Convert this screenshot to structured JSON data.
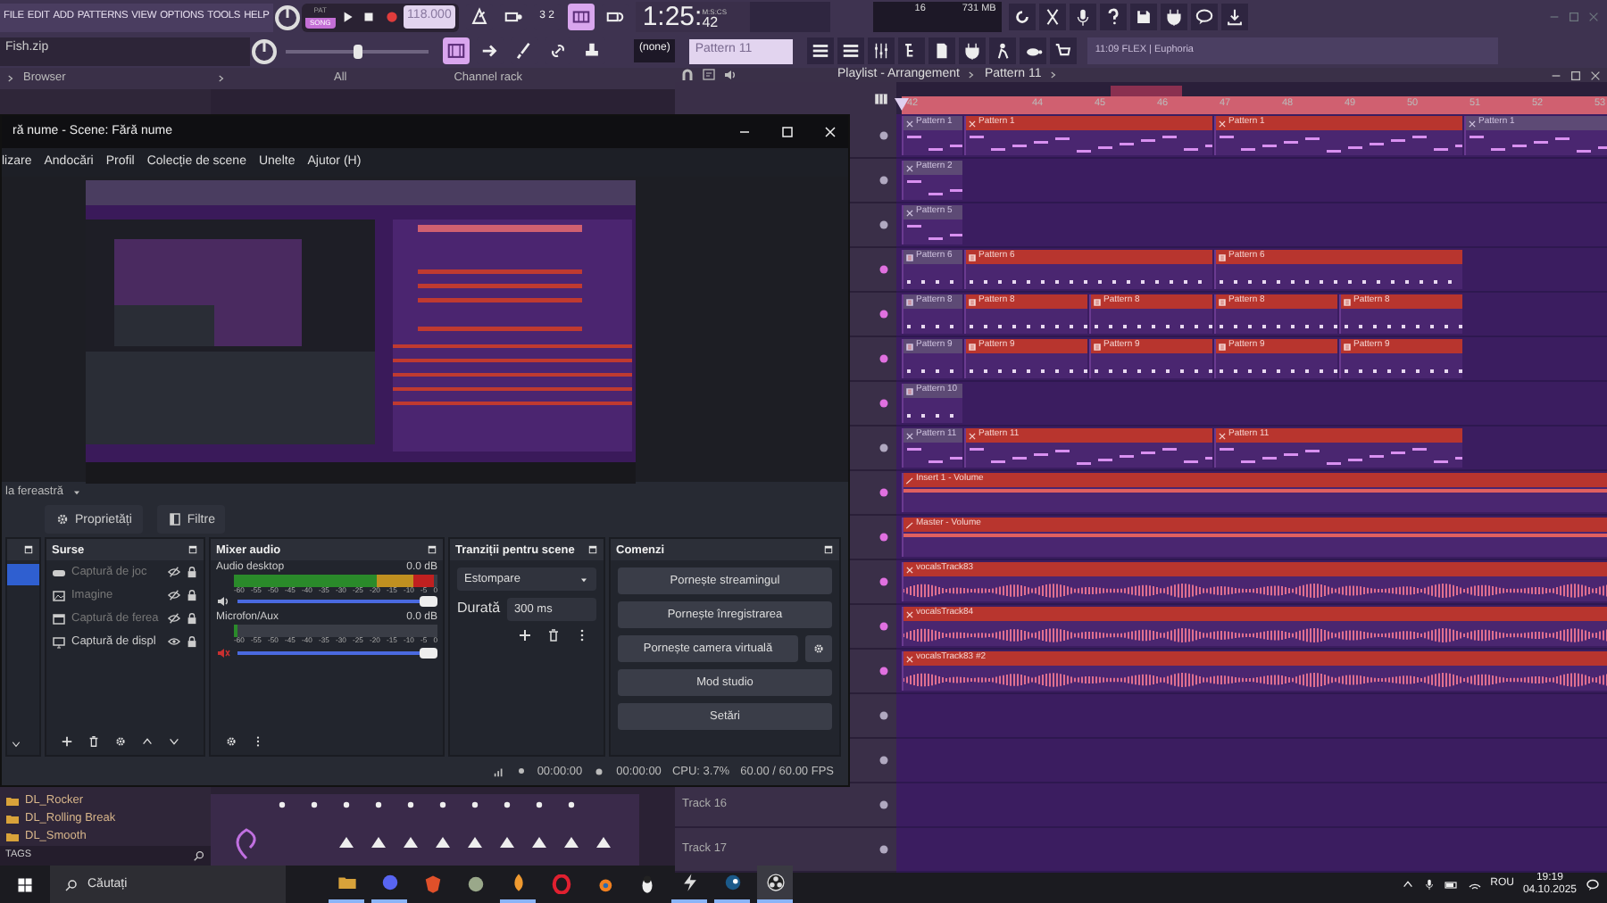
{
  "fl": {
    "menu": [
      "FILE",
      "EDIT",
      "ADD",
      "PATTERNS",
      "VIEW",
      "OPTIONS",
      "TOOLS",
      "HELP"
    ],
    "hint": "Fish.zip",
    "mode": {
      "pat_label": "PAT",
      "song_label": "SONG",
      "song_selected": true
    },
    "tempo": "118.000",
    "time": {
      "main": "1:25:",
      "small": "42",
      "unit": "M:S:CS"
    },
    "cpu": {
      "polyphony": "16",
      "memory": "731 MB"
    },
    "pitch": {
      "level": 0.5
    },
    "snap": "(none)",
    "pattern": "Pattern 11",
    "news": "11:09 FLEX | Euphoria",
    "toggles_top": [
      {
        "kind": "metronome",
        "on": false
      },
      {
        "kind": "wait",
        "on": false
      },
      {
        "kind": "countdown",
        "text": "3 2",
        "on": false
      },
      {
        "kind": "typing",
        "on": true
      },
      {
        "kind": "loop",
        "on": false
      }
    ],
    "toggles_bottom": [
      {
        "kind": "step",
        "on": true
      },
      {
        "kind": "arrow",
        "on": false
      },
      {
        "kind": "brush",
        "on": false
      },
      {
        "kind": "link",
        "on": false
      },
      {
        "kind": "stamp",
        "on": false
      }
    ]
  },
  "browser": {
    "title": "Browser",
    "items": [
      "DL_Rocker",
      "DL_Rolling Break",
      "DL_Smooth"
    ],
    "tags": "TAGS"
  },
  "channel_rack": {
    "filter": "All",
    "title": "Channel rack"
  },
  "playlist": {
    "title": "Playlist - Arrangement",
    "pattern": "Pattern 11",
    "ruler": [
      "42",
      "44",
      "45",
      "46",
      "47",
      "48",
      "49",
      "50",
      "51",
      "52",
      "53"
    ],
    "tracks": [
      {
        "kind": "notes",
        "clips": [
          {
            "label": "Pattern 1",
            "kind": "bar",
            "selected": false
          },
          {
            "label": "Pattern 1",
            "kind": "phrase",
            "selected": true
          },
          {
            "label": "Pattern 1",
            "kind": "phrase",
            "selected": true
          },
          {
            "label": "Pattern 1",
            "kind": "tail",
            "selected": false
          }
        ]
      },
      {
        "kind": "notes",
        "clips": [
          {
            "label": "Pattern 2",
            "kind": "bar",
            "selected": false
          }
        ]
      },
      {
        "kind": "notes",
        "clips": [
          {
            "label": "Pattern 5",
            "kind": "bar",
            "selected": false
          }
        ]
      },
      {
        "kind": "steps",
        "clips": [
          {
            "label": "Pattern 6",
            "kind": "bar",
            "selected": false
          },
          {
            "label": "Pattern 6",
            "kind": "phrase",
            "selected": true
          },
          {
            "label": "Pattern 6",
            "kind": "phrase",
            "selected": true
          }
        ]
      },
      {
        "kind": "steps",
        "clips": [
          {
            "label": "Pattern 8",
            "kind": "bar",
            "selected": false
          },
          {
            "label": "Pattern 8",
            "kind": "pair",
            "selected": true
          },
          {
            "label": "Pattern 8",
            "kind": "pair",
            "selected": true
          },
          {
            "label": "Pattern 8",
            "kind": "pair",
            "selected": true
          },
          {
            "label": "Pattern 8",
            "kind": "pair",
            "selected": true
          }
        ]
      },
      {
        "kind": "steps",
        "clips": [
          {
            "label": "Pattern 9",
            "kind": "bar",
            "selected": false
          },
          {
            "label": "Pattern 9",
            "kind": "pair",
            "selected": true
          },
          {
            "label": "Pattern 9",
            "kind": "pair",
            "selected": true
          },
          {
            "label": "Pattern 9",
            "kind": "pair",
            "selected": true
          },
          {
            "label": "Pattern 9",
            "kind": "pair",
            "selected": true
          }
        ]
      },
      {
        "kind": "steps",
        "clips": [
          {
            "label": "Pattern 10",
            "kind": "bar",
            "selected": false
          }
        ]
      },
      {
        "kind": "notes",
        "clips": [
          {
            "label": "Pattern 11",
            "kind": "bar",
            "selected": false
          },
          {
            "label": "Pattern 11",
            "kind": "phrase",
            "selected": true
          },
          {
            "label": "Pattern 11",
            "kind": "phrase",
            "selected": true
          }
        ]
      },
      {
        "kind": "automation",
        "clips": [
          {
            "label": "Insert 1 - Volume",
            "kind": "tail",
            "selected": true
          }
        ]
      },
      {
        "kind": "automation",
        "clips": [
          {
            "label": "Master - Volume",
            "kind": "tail",
            "selected": true
          }
        ]
      },
      {
        "kind": "audio",
        "clips": [
          {
            "label": "vocalsTrack83",
            "kind": "tail",
            "selected": true
          }
        ]
      },
      {
        "kind": "audio",
        "clips": [
          {
            "label": "vocalsTrack84",
            "kind": "tail",
            "selected": true
          }
        ]
      },
      {
        "kind": "audio",
        "clips": [
          {
            "label": "vocalsTrack83 #2",
            "kind": "tail",
            "selected": true
          }
        ]
      },
      {
        "kind": "empty"
      },
      {
        "kind": "empty"
      },
      {
        "kind": "empty",
        "name": "Track 16"
      },
      {
        "kind": "empty",
        "name": "Track 17"
      }
    ]
  },
  "obs": {
    "title": "ră nume - Scene: Fără nume",
    "menu": [
      "lizare",
      "Andocări",
      "Profil",
      "Colecție de scene",
      "Unelte",
      "Ajutor (H)"
    ],
    "source_label": "la fereastră",
    "properties": "Proprietăți",
    "filters": "Filtre",
    "scenes": [
      {
        "selected": true
      }
    ],
    "sources": {
      "title": "Surse",
      "items": [
        {
          "kind": "game",
          "name": "Captură de joc",
          "visible": false
        },
        {
          "kind": "image",
          "name": "Imagine",
          "visible": false
        },
        {
          "kind": "window",
          "name": "Captură de ferea",
          "visible": false
        },
        {
          "kind": "display",
          "name": "Captură de displ",
          "visible": true
        }
      ]
    },
    "mixer": {
      "title": "Mixer audio",
      "channels": [
        {
          "name": "Audio desktop",
          "db": "0.0 dB",
          "muted": false,
          "meter": {
            "level": 0.98
          },
          "volume": {
            "level": 1
          },
          "ticks": [
            "-60",
            "-55",
            "-50",
            "-45",
            "-40",
            "-35",
            "-30",
            "-25",
            "-20",
            "-15",
            "-10",
            "-5",
            "0"
          ]
        },
        {
          "name": "Microfon/Aux",
          "db": "0.0 dB",
          "muted": true,
          "meter": {
            "level": 0.02
          },
          "volume": {
            "level": 1
          },
          "ticks": [
            "-60",
            "-55",
            "-50",
            "-45",
            "-40",
            "-35",
            "-30",
            "-25",
            "-20",
            "-15",
            "-10",
            "-5",
            "0"
          ]
        }
      ]
    },
    "transitions": {
      "title": "Tranziții pentru scene",
      "type": "Estompare",
      "duration_label": "Durată",
      "duration": "300 ms"
    },
    "controls": {
      "title": "Comenzi",
      "buttons": [
        {
          "label": "Pornește streamingul"
        },
        {
          "label": "Pornește înregistrarea"
        },
        {
          "label": "Pornește camera virtuală",
          "settings": true
        },
        {
          "label": "Mod studio"
        },
        {
          "label": "Setări"
        }
      ]
    },
    "status": {
      "stream_time": "00:00:00",
      "record_time": "00:00:00",
      "cpu": "CPU: 3.7%",
      "fps": "60.00 / 60.00 FPS"
    }
  },
  "taskbar": {
    "search": "Căutați",
    "apps": [
      {
        "kind": "folder",
        "running": true,
        "selected": false
      },
      {
        "kind": "chat",
        "running": true,
        "selected": false
      },
      {
        "kind": "browser",
        "running": false,
        "selected": false
      },
      {
        "kind": "tool",
        "running": false,
        "selected": false
      },
      {
        "kind": "daw",
        "running": true,
        "selected": false
      },
      {
        "kind": "opera",
        "running": false,
        "selected": false
      },
      {
        "kind": "blender",
        "running": false,
        "selected": false
      },
      {
        "kind": "penguin",
        "running": false,
        "selected": false
      },
      {
        "kind": "bolt",
        "running": true,
        "selected": false
      },
      {
        "kind": "steam",
        "running": true,
        "selected": false
      },
      {
        "kind": "obs",
        "running": true,
        "selected": true
      }
    ],
    "lang": "ROU",
    "time": "19:19",
    "date": "04.10.2025"
  }
}
